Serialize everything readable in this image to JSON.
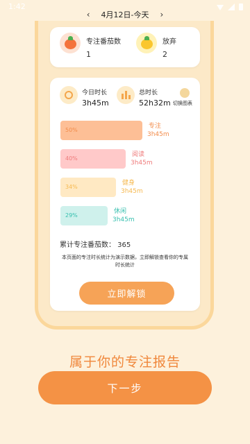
{
  "status": {
    "time": "1:42"
  },
  "date_nav": {
    "prev": "‹",
    "label": "4月12日-今天",
    "next": "›"
  },
  "summary": {
    "tomatoes_label": "专注番茄数",
    "tomatoes_value": "1",
    "giveup_label": "放弃",
    "giveup_value": "2"
  },
  "overview": {
    "today_label": "今日时长",
    "today_value": "3h45m",
    "total_label": "总时长",
    "total_value": "52h32m",
    "switch_label": "切换图表"
  },
  "categories": [
    {
      "percent": "50%",
      "name": "专注",
      "time": "3h45m",
      "bar_color": "#FDBF96",
      "text_color": "#F28C4B",
      "level": 50
    },
    {
      "percent": "40%",
      "name": "阅读",
      "time": "3h45m",
      "bar_color": "#FFC9C9",
      "text_color": "#EF7B7B",
      "level": 40
    },
    {
      "percent": "34%",
      "name": "健身",
      "time": "3h45m",
      "bar_color": "#FFE9C3",
      "text_color": "#F6B950",
      "level": 34
    },
    {
      "percent": "29%",
      "name": "休闲",
      "time": "3h45m",
      "bar_color": "#CFF1EC",
      "text_color": "#35BFAE",
      "level": 29
    }
  ],
  "total_tomatoes": "累计专注番茄数：  365",
  "notice": "本页面的专注时长统计为演示数据，立即解锁查看你的专属时长统计",
  "unlock_button": "立即解锁",
  "footer_title": "属于你的专注报告",
  "next_button": "下一步",
  "colors": {
    "accent": "#F49245",
    "background": "#FDF1DC"
  }
}
